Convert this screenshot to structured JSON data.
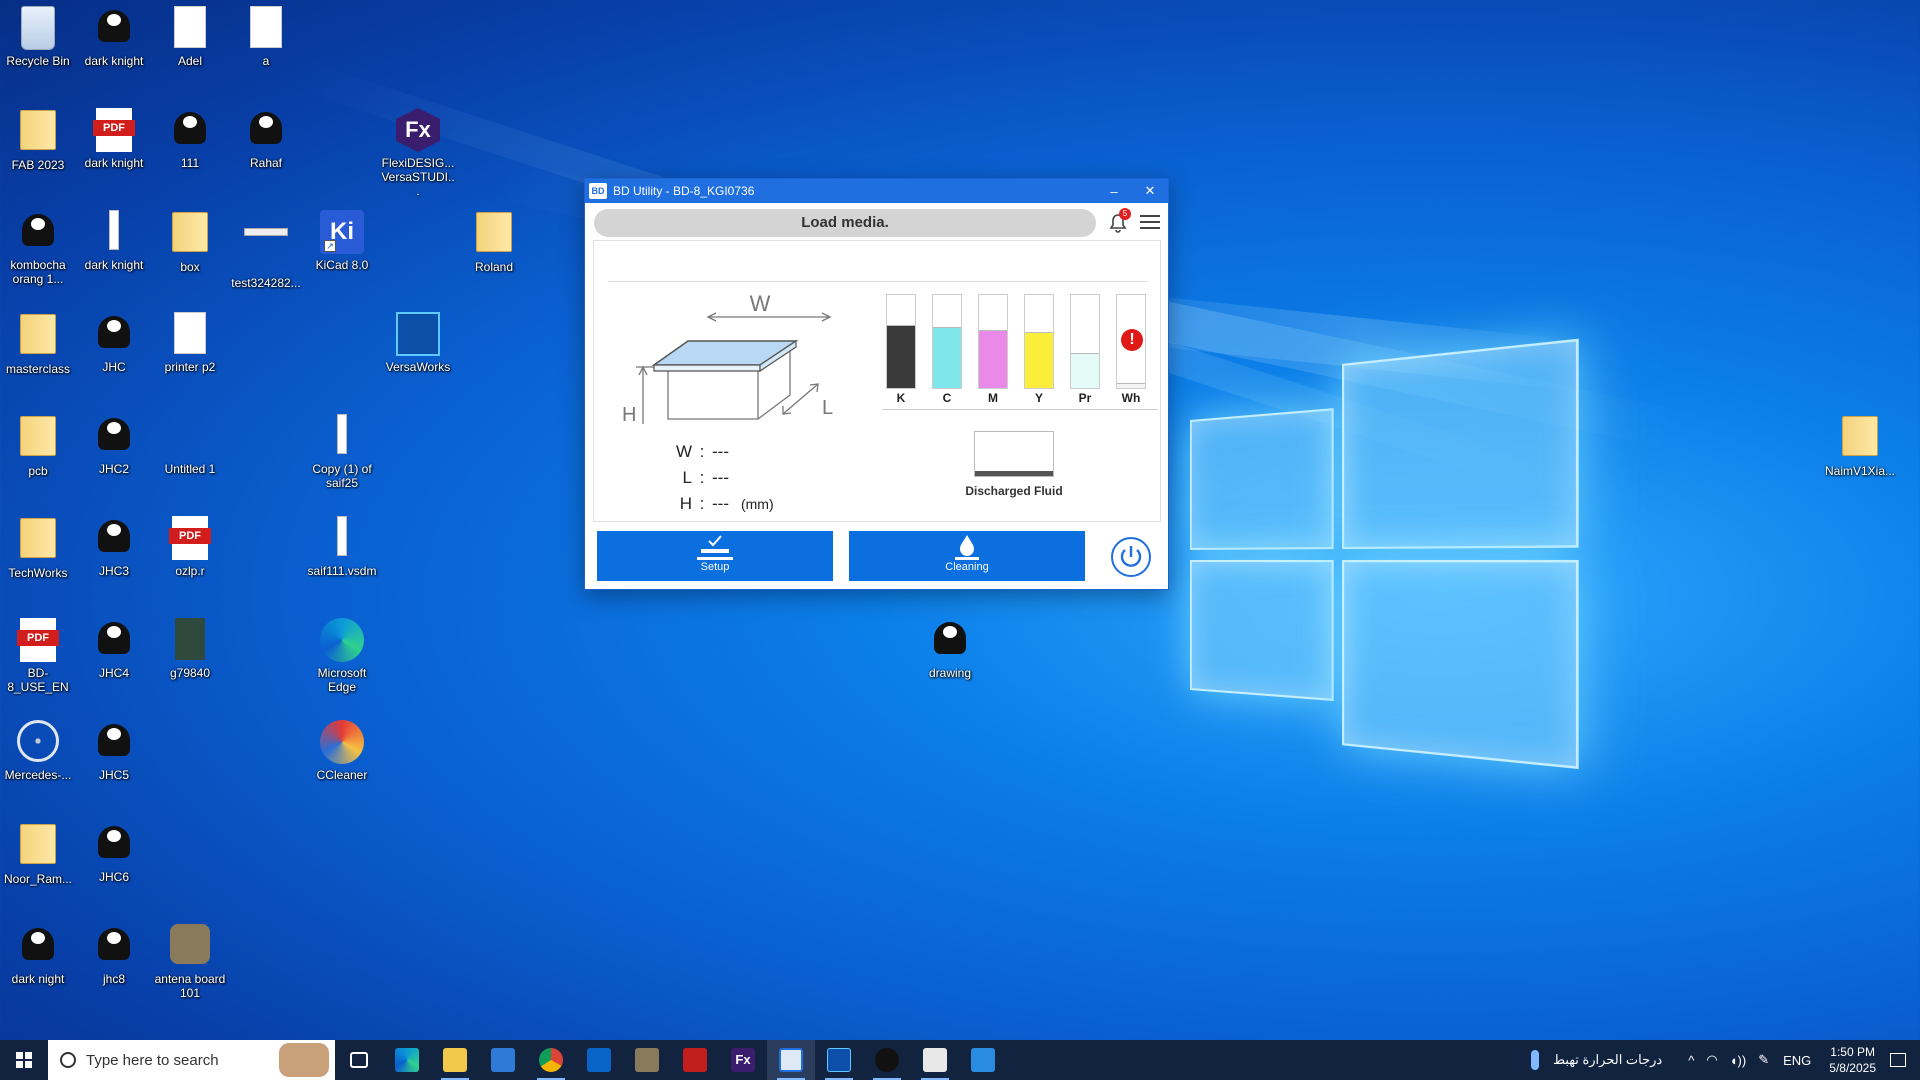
{
  "desktop": {
    "icons": [
      {
        "label": "Recycle Bin"
      },
      {
        "label": "dark knight"
      },
      {
        "label": "Adel"
      },
      {
        "label": "a"
      },
      {
        "label": "FAB 2023"
      },
      {
        "label": "dark knight"
      },
      {
        "label": "111"
      },
      {
        "label": "Rahaf"
      },
      {
        "label": "FlexiDESIG... VersaSTUDI..."
      },
      {
        "label": "kombocha orang 1..."
      },
      {
        "label": "dark knight"
      },
      {
        "label": "box"
      },
      {
        "label": "test324282..."
      },
      {
        "label": "KiCad 8.0"
      },
      {
        "label": "Roland"
      },
      {
        "label": "masterclass"
      },
      {
        "label": "JHC"
      },
      {
        "label": "printer p2"
      },
      {
        "label": "VersaWorks"
      },
      {
        "label": "pcb"
      },
      {
        "label": "JHC2"
      },
      {
        "label": "Untitled 1"
      },
      {
        "label": "Copy (1) of saif25"
      },
      {
        "label": "NaimV1Xia..."
      },
      {
        "label": "TechWorks"
      },
      {
        "label": "JHC3"
      },
      {
        "label": "ozlp.r"
      },
      {
        "label": "saif111.vsdm"
      },
      {
        "label": "BD-8_USE_EN"
      },
      {
        "label": "JHC4"
      },
      {
        "label": "g79840"
      },
      {
        "label": "Microsoft Edge"
      },
      {
        "label": "drawing"
      },
      {
        "label": "Mercedes-..."
      },
      {
        "label": "JHC5"
      },
      {
        "label": "CCleaner"
      },
      {
        "label": "Noor_Ram..."
      },
      {
        "label": "JHC6"
      },
      {
        "label": "dark night"
      },
      {
        "label": "jhc8"
      },
      {
        "label": "antena board 101"
      }
    ],
    "icon_glyphs": {
      "pdf": "PDF",
      "fx": "Fx",
      "kicad": "Ki"
    }
  },
  "app": {
    "title": "BD Utility - BD-8_KGI0736",
    "logo_text": "BD",
    "minimize": "–",
    "close": "✕",
    "status": "Load media.",
    "notifications": "5",
    "diagram": {
      "w": "W",
      "l": "L",
      "h": "H"
    },
    "dims": {
      "w_key": "W",
      "l_key": "L",
      "h_key": "H",
      "sep": ":",
      "w_val": "---",
      "l_val": "---",
      "h_val": "---",
      "unit": "(mm)"
    },
    "inks": [
      {
        "label": "K",
        "level": 0.68,
        "color": "#3a3a3a"
      },
      {
        "label": "C",
        "level": 0.66,
        "color": "#7fe7ea"
      },
      {
        "label": "M",
        "level": 0.62,
        "color": "#e98ae8"
      },
      {
        "label": "Y",
        "level": 0.6,
        "color": "#fbee3a"
      },
      {
        "label": "Pr",
        "level": 0.38,
        "color": "#e4fbf7"
      },
      {
        "label": "Wh",
        "level": 0.05,
        "color": "#f4f4f4",
        "warning": "!"
      }
    ],
    "discharged": {
      "label": "Discharged Fluid",
      "level": 0.1
    },
    "buttons": {
      "setup": "Setup",
      "cleaning": "Cleaning"
    }
  },
  "taskbar": {
    "search_placeholder": "Type here to search",
    "weather": "درجات الحرارة تهبط",
    "lang": "ENG",
    "time": "1:50 PM",
    "date": "5/8/2025",
    "tray_chevron": "^"
  },
  "colors": {
    "accent": "#1f6fe0",
    "button": "#0b6fe0",
    "taskbar": "#12233f",
    "warning": "#e01818"
  }
}
